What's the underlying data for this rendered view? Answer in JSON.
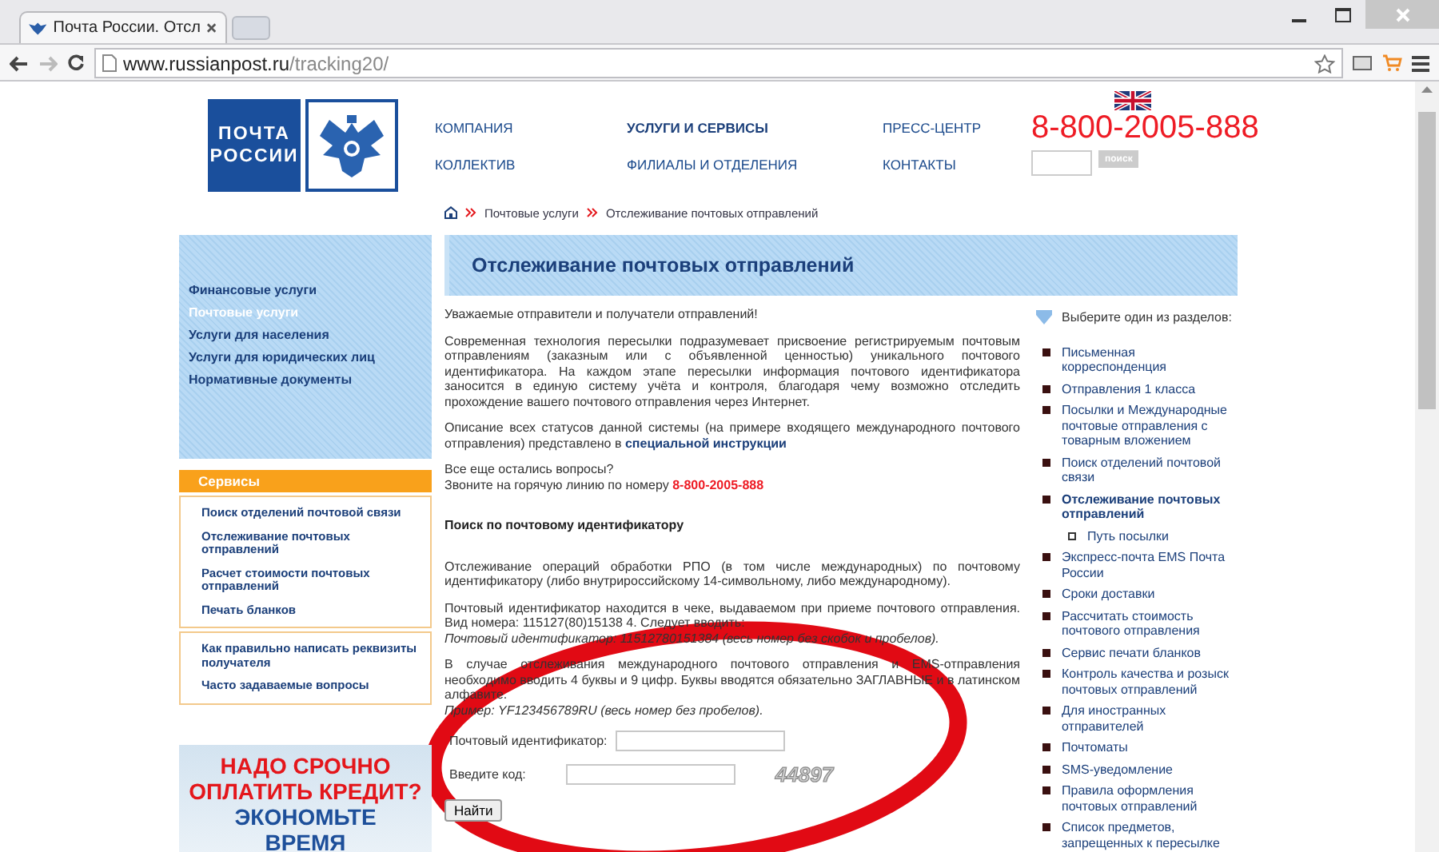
{
  "browser": {
    "tab_title": "Почта России. Отсл",
    "url_host": "www.russianpost.ru",
    "url_path": "/tracking20/"
  },
  "header": {
    "logo_lines": [
      "ПОЧТА",
      "РОССИИ"
    ],
    "nav": [
      {
        "label": "КОМПАНИЯ",
        "selected": false
      },
      {
        "label": "УСЛУГИ И СЕРВИСЫ",
        "selected": true
      },
      {
        "label": "ПРЕСС-ЦЕНТР",
        "selected": false
      },
      {
        "label": "КОЛЛЕКТИВ",
        "selected": false
      },
      {
        "label": "ФИЛИАЛЫ И ОТДЕЛЕНИЯ",
        "selected": false
      },
      {
        "label": "КОНТАКТЫ",
        "selected": false
      }
    ],
    "phone": "8-800-2005-888",
    "search_button": "поиск"
  },
  "breadcrumbs": [
    "Почтовые услуги",
    "Отслеживание почтовых отправлений"
  ],
  "left_menu": [
    {
      "label": "Финансовые услуги",
      "selected": false
    },
    {
      "label": "Почтовые услуги",
      "selected": true
    },
    {
      "label": "Услуги для населения",
      "selected": false
    },
    {
      "label": "Услуги для юридических лиц",
      "selected": false
    },
    {
      "label": "Нормативные документы",
      "selected": false
    }
  ],
  "services": {
    "title": "Сервисы",
    "groups": [
      [
        "Поиск отделений почтовой связи",
        "Отслеживание почтовых отправлений",
        "Расчет стоимости почтовых отправлений",
        "Печать бланков"
      ],
      [
        "Как правильно написать реквизиты получателя",
        "Часто задаваемые вопросы"
      ]
    ]
  },
  "ad": {
    "lines": [
      {
        "text": "НАДО СРОЧНО",
        "color": "#e4161b"
      },
      {
        "text": "ОПЛАТИТЬ КРЕДИТ?",
        "color": "#e4161b"
      },
      {
        "text": "ЭКОНОМЬТЕ",
        "color": "#1d4f9a"
      },
      {
        "text": "ВРЕМЯ",
        "color": "#1d4f9a"
      }
    ]
  },
  "main": {
    "title": "Отслеживание почтовых отправлений",
    "intro": [
      {
        "text": "Уважаемые отправители и получатели отправлений!"
      },
      {
        "text": "Современная технология пересылки подразумевает присвоение регистрируемым почтовым отправлениям (заказным или с объявленной ценностью) уникального почтового идентификатора. На каждом этапе пересылки информация почтового идентификатора заносится в единую систему учёта и контроля, благодаря чему возможно отследить прохождение вашего почтового отправления через Интернет."
      },
      {
        "text": "Описание всех статусов данной системы (на примере входящего международного почтового отправления) представлено в",
        "link": "специальной инструкции"
      }
    ],
    "questions": {
      "line1": "Все еще остались вопросы?",
      "line2": "Звоните на горячую линию по номеру",
      "phone": "8-800-2005-888"
    },
    "search_title": "Поиск по почтовому идентификатору",
    "notes": [
      {
        "text": "Отслеживание операций обработки РПО (в том числе международных) по почтовому идентификатору (либо внутрироссийскому 14-символьному, либо международному)."
      },
      {
        "text": "Почтовый идентификатор находится в чеке, выдаваемом при приеме почтового отправления. Вид номера: 115127(80)15138 4. Следует вводить:",
        "example": "Почтовый идентификатор: 11512780151384 (весь номер без скобок и пробелов)."
      },
      {
        "text": "В случае отслеживания международного почтового отправления и EMS-отправления необходимо вводить 4 буквы и 9 цифр. Буквы вводятся обязательно ЗАГЛАВНЫЕ и в латинском алфавите.",
        "example": "Пример: YF123456789RU (весь номер без пробелов)."
      }
    ],
    "form": {
      "fields": [
        {
          "label": "Почтовый идентификатор:"
        },
        {
          "label": "Введите код:",
          "captcha": "44897"
        }
      ],
      "button": "Найти"
    }
  },
  "right_menu": {
    "heading": "Выберите один из разделов:",
    "items": [
      {
        "label": "Письменная корреспонденция",
        "selected": false
      },
      {
        "label": "Отправления 1 класса",
        "selected": false
      },
      {
        "label": "Посылки и Международные почтовые отправления с товарным вложением",
        "selected": false
      },
      {
        "label": "Поиск отделений почтовой связи",
        "selected": false
      },
      {
        "label": "Отслеживание почтовых отправлений",
        "selected": true,
        "children": [
          {
            "label": "Путь посылки",
            "selected": false
          }
        ]
      },
      {
        "label": "Экспресс-почта EMS Почта России",
        "selected": false
      },
      {
        "label": "Сроки доставки",
        "selected": false
      },
      {
        "label": "Рассчитать стоимость почтового отправления",
        "selected": false
      },
      {
        "label": "Сервис печати бланков",
        "selected": false
      },
      {
        "label": "Контроль качества и розыск почтовых отправлений",
        "selected": false
      },
      {
        "label": "Для иностранных отправителей",
        "selected": false
      },
      {
        "label": "Почтоматы",
        "selected": false
      },
      {
        "label": "SMS-уведомление",
        "selected": false
      },
      {
        "label": "Правила оформления почтовых отправлений",
        "selected": false
      },
      {
        "label": "Список предметов, запрещенных к пересылке",
        "selected": false
      }
    ]
  }
}
